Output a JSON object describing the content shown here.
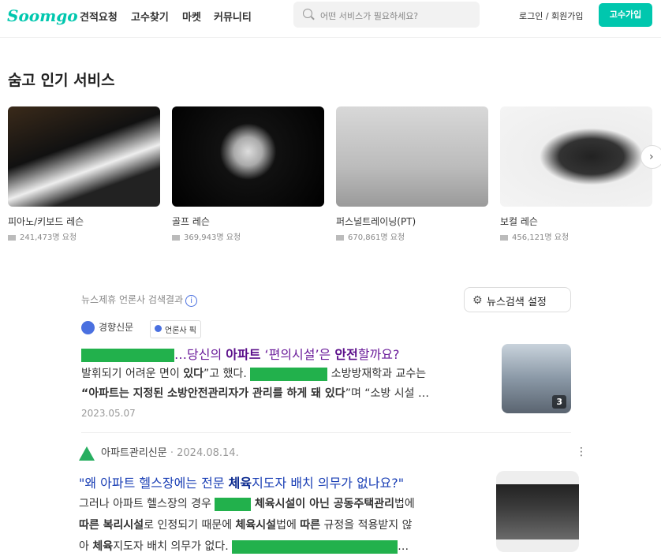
{
  "header": {
    "logo": "Soomgo",
    "nav": [
      "견적요청",
      "고수찾기",
      "마켓",
      "커뮤니티"
    ],
    "search_placeholder": "어떤 서비스가 필요하세요?",
    "login": "로그인 / 회원가입",
    "join": "고수가입"
  },
  "popular": {
    "title": "숨고 인기 서비스",
    "items": [
      {
        "name": "피아노/키보드 레슨",
        "count": "241,473명 요청"
      },
      {
        "name": "골프 레슨",
        "count": "369,943명 요청"
      },
      {
        "name": "퍼스널트레이닝(PT)",
        "count": "670,861명 요청"
      },
      {
        "name": "보컬 레슨",
        "count": "456,121명 요청"
      }
    ]
  },
  "news": {
    "header": "뉴스제휴 언론사 검색결과",
    "settings": "뉴스검색 설정",
    "a1": {
      "publisher": "경향신문",
      "pick": "언론사 픽",
      "title": [
        "…당신의 ",
        "아파트",
        " ‘편의시설’은 ",
        "안전",
        "할까요?"
      ],
      "line1": [
        "발휘되기 어려운 면이 ",
        "있다",
        "”고 했다. ",
        "소방방재학과 교수는"
      ],
      "line2": [
        "“아파트는 지정된 소방안전관리자가 관리를 하게 돼 있다",
        "”며 “소방 시설 …"
      ],
      "date": "2023.05.07",
      "thumb_count": "3"
    },
    "a2": {
      "publisher": "아파트관리신문",
      "date": "· 2024.08.14.",
      "title": [
        "\"왜 아파트 헬스장에는 전문 ",
        "체육",
        "지도자 배치 의무가 없나요?\""
      ],
      "line1": [
        "그러나 아파트 헬스장의 경우 ",
        "체육시설이 아닌 공동주택관리",
        "법에"
      ],
      "line2": [
        "따른 복리시설",
        "로 인정되기 때문에 ",
        "체육시설",
        "법에 ",
        "따른",
        " 규정을 적용받지 않"
      ],
      "line3": [
        "아 ",
        "체육",
        "지도자 배치 의무가 없다. ",
        "…"
      ]
    }
  }
}
